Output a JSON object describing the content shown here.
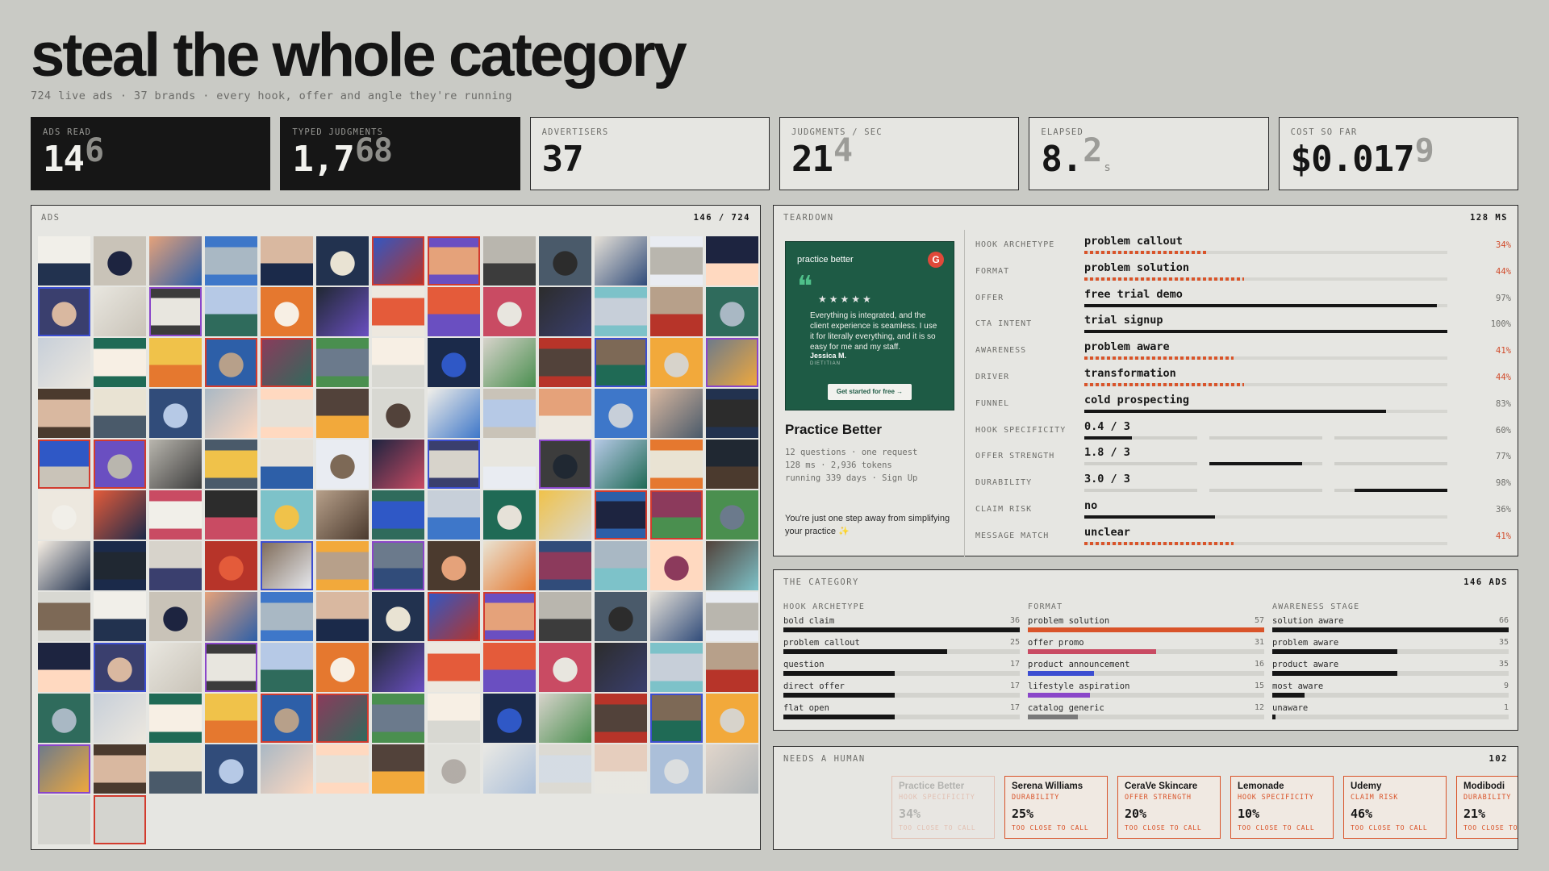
{
  "header": {
    "title": "steal the whole category",
    "subtitle": "724 live ads · 37 brands · every hook, offer and angle they're running"
  },
  "stats": [
    {
      "label": "ADS READ",
      "value": "14",
      "ghost": "6",
      "unit": "",
      "dark": true
    },
    {
      "label": "TYPED JUDGMENTS",
      "value": "1,7",
      "ghost": "68",
      "unit": "",
      "dark": true
    },
    {
      "label": "ADVERTISERS",
      "value": "37",
      "ghost": "",
      "unit": "",
      "dark": false
    },
    {
      "label": "JUDGMENTS / SEC",
      "value": "21",
      "ghost": "4",
      "unit": "",
      "dark": false
    },
    {
      "label": "ELAPSED",
      "value": "8.",
      "ghost": "2",
      "unit": "s",
      "dark": false
    },
    {
      "label": "COST SO FAR",
      "value": "$0.017",
      "ghost": "9",
      "unit": "",
      "dark": false
    }
  ],
  "ads_panel": {
    "label": "ADS",
    "count": "146 / 724",
    "colors": [
      "#f1efe9",
      "#c9c3b8",
      "#e5a27a",
      "#3e77c9",
      "#d9b8a0",
      "#22324f",
      "#2f58c6",
      "#6a4fc1",
      "#b9b6ae",
      "#4a5a6a",
      "#e6e1d8",
      "#e9ecf2",
      "#1d2440",
      "#3a3f6e",
      "#e8e6df",
      "#3c3c3c",
      "#b6c9e6",
      "#e5782f",
      "#202832",
      "#ede8df",
      "#e45b3a",
      "#c94b63",
      "#2c2c2c",
      "#7dc2c9",
      "#b7a08a",
      "#2f6b5c",
      "#c7cfd9",
      "#1f6a55",
      "#f0c24a",
      "#2d5fa8",
      "#8c3a5c",
      "#4a8f4f",
      "#f7efe4",
      "#1b2a4a",
      "#d7d3cb",
      "#b73429",
      "#7d6956",
      "#f2a93b",
      "#6b7a8c",
      "#4b3a2e",
      "#e9e3d3",
      "#314c7a",
      "#a9b8c4",
      "#ffd9c0",
      "#52423a",
      "#d8d8d2"
    ]
  },
  "teardown": {
    "label": "TEARDOWN",
    "time": "128 MS",
    "creative": {
      "brand": "practice better",
      "quote_mark": "❝",
      "stars": "★★★★★",
      "text": "Everything is integrated, and the client experience is seamless. I use it for literally everything, and it is so easy for me and my staff.",
      "who": "Jessica M.",
      "who_sub": "DIETITIAN",
      "cta": "Get started for free →",
      "g": "G"
    },
    "name": "Practice Better",
    "meta": [
      "12 questions · one request",
      "128 ms · 2,936 tokens",
      "running 339 days · Sign Up"
    ],
    "copy": "You're just one step away from simplifying your practice ✨",
    "rows": [
      {
        "k": "HOOK ARCHETYPE",
        "v": "problem callout",
        "pct": "34%",
        "p": 0.34,
        "style": "dash",
        "warn": true
      },
      {
        "k": "FORMAT",
        "v": "problem solution",
        "pct": "44%",
        "p": 0.44,
        "style": "dash",
        "warn": true
      },
      {
        "k": "OFFER",
        "v": "free trial demo",
        "pct": "97%",
        "p": 0.97,
        "style": "solid",
        "warn": false
      },
      {
        "k": "CTA INTENT",
        "v": "trial signup",
        "pct": "100%",
        "p": 1.0,
        "style": "solid",
        "warn": false
      },
      {
        "k": "AWARENESS",
        "v": "problem aware",
        "pct": "41%",
        "p": 0.41,
        "style": "dash",
        "warn": true
      },
      {
        "k": "DRIVER",
        "v": "transformation",
        "pct": "44%",
        "p": 0.44,
        "style": "dash",
        "warn": true
      },
      {
        "k": "FUNNEL",
        "v": "cold prospecting",
        "pct": "83%",
        "p": 0.83,
        "style": "solid",
        "warn": false
      },
      {
        "k": "HOOK SPECIFICITY",
        "v": "0.4 / 3",
        "pct": "60%",
        "p": 0.13,
        "style": "scale",
        "warn": false
      },
      {
        "k": "OFFER STRENGTH",
        "v": "1.8 / 3",
        "pct": "77%",
        "p": 0.6,
        "style": "scale",
        "warn": false
      },
      {
        "k": "DURABILITY",
        "v": "3.0 / 3",
        "pct": "98%",
        "p": 1.0,
        "style": "scale",
        "warn": false
      },
      {
        "k": "CLAIM RISK",
        "v": "no",
        "pct": "36%",
        "p": 0.36,
        "style": "solid",
        "warn": false
      },
      {
        "k": "MESSAGE MATCH",
        "v": "unclear",
        "pct": "41%",
        "p": 0.41,
        "style": "dash",
        "warn": true
      }
    ]
  },
  "category": {
    "label": "THE CATEGORY",
    "count": "146 ADS",
    "columns": [
      {
        "h": "HOOK ARCHETYPE",
        "max": 36,
        "color": "#161616",
        "items": [
          {
            "n": "bold claim",
            "c": 36
          },
          {
            "n": "problem callout",
            "c": 25
          },
          {
            "n": "question",
            "c": 17
          },
          {
            "n": "direct offer",
            "c": 17
          },
          {
            "n": "flat open",
            "c": 17
          }
        ]
      },
      {
        "h": "FORMAT",
        "max": 57,
        "colors": [
          "#d9542a",
          "#c94b63",
          "#3c4ed1",
          "#8a46c9",
          "#7a7a7a"
        ],
        "items": [
          {
            "n": "problem solution",
            "c": 57
          },
          {
            "n": "offer promo",
            "c": 31
          },
          {
            "n": "product announcement",
            "c": 16
          },
          {
            "n": "lifestyle aspiration",
            "c": 15
          },
          {
            "n": "catalog generic",
            "c": 12
          }
        ]
      },
      {
        "h": "AWARENESS STAGE",
        "max": 66,
        "color": "#161616",
        "items": [
          {
            "n": "solution aware",
            "c": 66
          },
          {
            "n": "problem aware",
            "c": 35
          },
          {
            "n": "product aware",
            "c": 35
          },
          {
            "n": "most aware",
            "c": 9
          },
          {
            "n": "unaware",
            "c": 1
          }
        ]
      }
    ]
  },
  "human": {
    "label": "NEEDS A HUMAN",
    "count": "102",
    "cards": [
      {
        "b": "Practice Better",
        "d": "HOOK SPECIFICITY",
        "p": "34%",
        "t": "TOO CLOSE TO CALL",
        "faded": true
      },
      {
        "b": "Serena Williams",
        "d": "DURABILITY",
        "p": "25%",
        "t": "TOO CLOSE TO CALL",
        "faded": false
      },
      {
        "b": "CeraVe Skincare",
        "d": "OFFER STRENGTH",
        "p": "20%",
        "t": "TOO CLOSE TO CALL",
        "faded": false
      },
      {
        "b": "Lemonade",
        "d": "HOOK SPECIFICITY",
        "p": "10%",
        "t": "TOO CLOSE TO CALL",
        "faded": false
      },
      {
        "b": "Udemy",
        "d": "CLAIM RISK",
        "p": "46%",
        "t": "TOO CLOSE TO CALL",
        "faded": false
      },
      {
        "b": "Modibodi",
        "d": "DURABILITY",
        "p": "21%",
        "t": "TOO CLOSE TO CALL",
        "faded": false
      }
    ]
  }
}
